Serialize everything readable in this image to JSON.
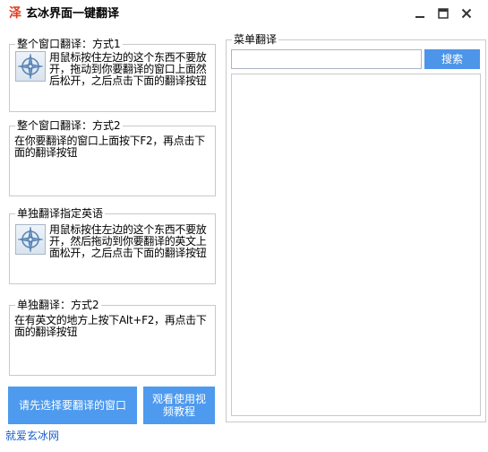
{
  "app": {
    "icon_glyph": "泽",
    "title": "玄冰界面一键翻译"
  },
  "groups": {
    "window_mode1": {
      "legend": "整个窗口翻译：方式1",
      "text": "用鼠标按住左边的这个东西不要放开，拖动到你要翻译的窗口上面然后松开，之后点击下面的翻译按钮"
    },
    "window_mode2": {
      "legend": "整个窗口翻译：方式2",
      "text": "在你要翻译的窗口上面按下F2，再点击下面的翻译按钮"
    },
    "single_specified": {
      "legend": "单独翻译指定英语",
      "text": "用鼠标按住左边的这个东西不要放开，然后拖动到你要翻译的英文上面松开，之后点击下面的翻译按钮"
    },
    "single_mode2": {
      "legend": "单独翻译：方式2",
      "text": "在有英文的地方上按下Alt+F2，再点击下面的翻译按钮"
    },
    "menu_translate": {
      "legend": "菜单翻译"
    }
  },
  "search": {
    "value": "",
    "placeholder": "",
    "button_label": "搜索"
  },
  "buttons": {
    "select_window": "请先选择要翻译的窗口",
    "watch_video": "观看使用视频教程"
  },
  "footer": {
    "link_text": "就爱玄冰网"
  },
  "icons": {
    "target": "crosshair-target-icon",
    "minimize": "minimize-icon",
    "maximize": "maximize-icon",
    "close": "close-icon"
  },
  "colors": {
    "accent": "#4d9aee",
    "search_button": "#4d95e8",
    "app_icon": "#e23b1e",
    "link": "#1a5fc9"
  }
}
